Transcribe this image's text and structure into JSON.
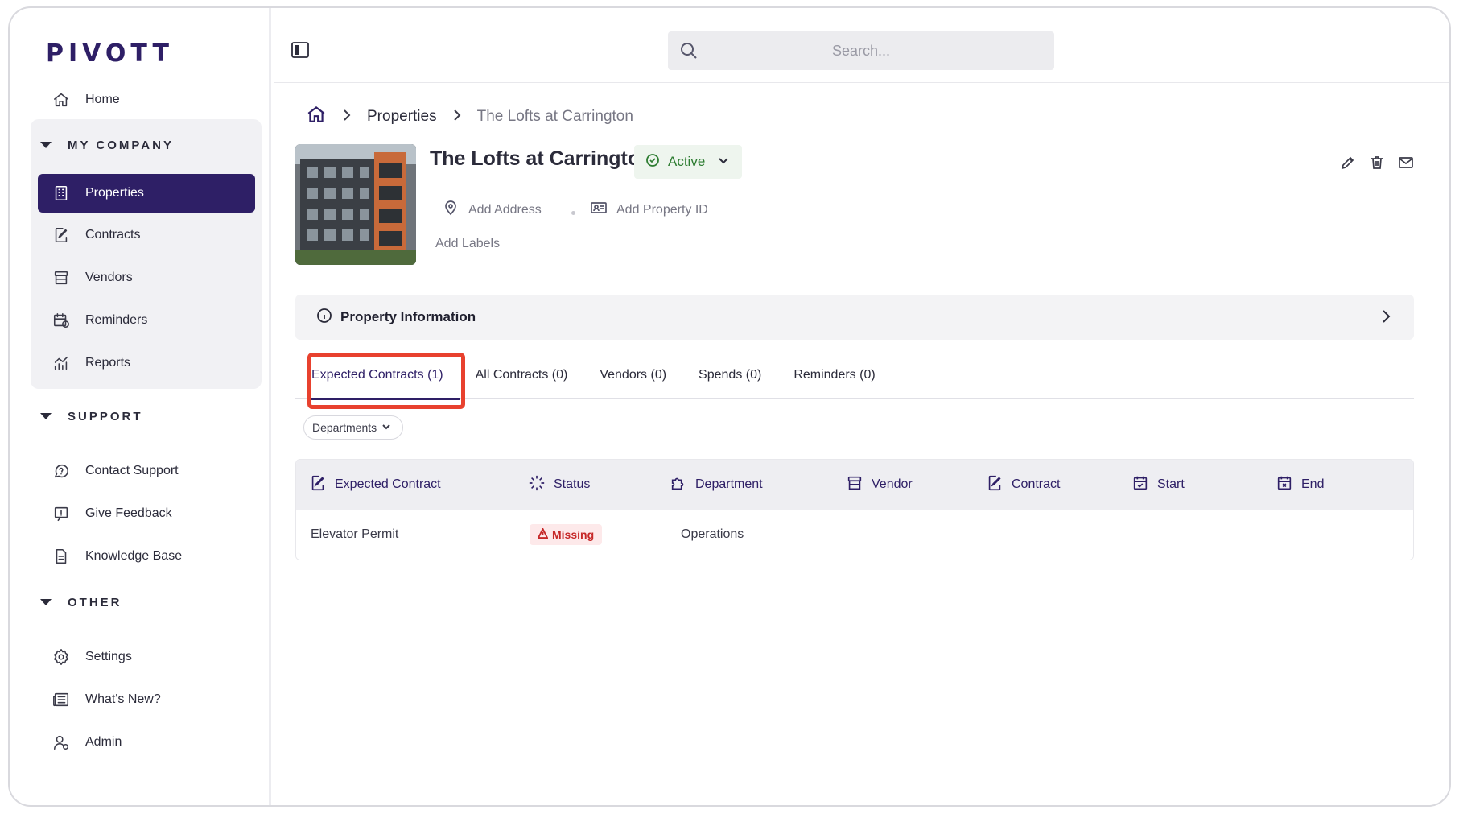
{
  "app": {
    "logo_text": "PIVOTT"
  },
  "sidebar": {
    "home": {
      "label": "Home",
      "icon": "home-icon"
    },
    "sections": [
      {
        "title": "MY COMPANY",
        "items": [
          {
            "label": "Properties",
            "icon": "building-icon",
            "active": true
          },
          {
            "label": "Contracts",
            "icon": "contract-icon"
          },
          {
            "label": "Vendors",
            "icon": "store-icon"
          },
          {
            "label": "Reminders",
            "icon": "calendar-clock-icon"
          },
          {
            "label": "Reports",
            "icon": "chart-icon"
          }
        ]
      },
      {
        "title": "SUPPORT",
        "items": [
          {
            "label": "Contact Support",
            "icon": "chat-help-icon"
          },
          {
            "label": "Give Feedback",
            "icon": "feedback-icon"
          },
          {
            "label": "Knowledge Base",
            "icon": "document-icon"
          }
        ]
      },
      {
        "title": "OTHER",
        "items": [
          {
            "label": "Settings",
            "icon": "gear-icon"
          },
          {
            "label": "What's New?",
            "icon": "news-icon"
          },
          {
            "label": "Admin",
            "icon": "admin-user-icon"
          }
        ]
      }
    ]
  },
  "topbar": {
    "search_placeholder": "Search..."
  },
  "breadcrumb": {
    "items": [
      "Properties",
      "The Lofts at Carrington"
    ]
  },
  "property": {
    "title": "The Lofts at Carrington",
    "status": "Active",
    "status_color": "#2e7d32",
    "add_address": "Add Address",
    "add_property_id": "Add Property ID",
    "add_labels": "Add Labels"
  },
  "accordion": {
    "label": "Property Information"
  },
  "tabs": [
    {
      "label": "Expected Contracts (1)",
      "active": true
    },
    {
      "label": "All Contracts (0)"
    },
    {
      "label": "Vendors (0)"
    },
    {
      "label": "Spends (0)"
    },
    {
      "label": "Reminders (0)"
    }
  ],
  "filter": {
    "departments_label": "Departments"
  },
  "table": {
    "columns": [
      "Expected Contract",
      "Status",
      "Department",
      "Vendor",
      "Contract",
      "Start",
      "End"
    ],
    "rows": [
      {
        "expected_contract": "Elevator Permit",
        "status": "Missing",
        "department": "Operations",
        "vendor": "",
        "contract": "",
        "start": "",
        "end": ""
      }
    ]
  },
  "colors": {
    "brand": "#2e1f66",
    "highlight": "#e8412e",
    "missing": "#c62828"
  }
}
